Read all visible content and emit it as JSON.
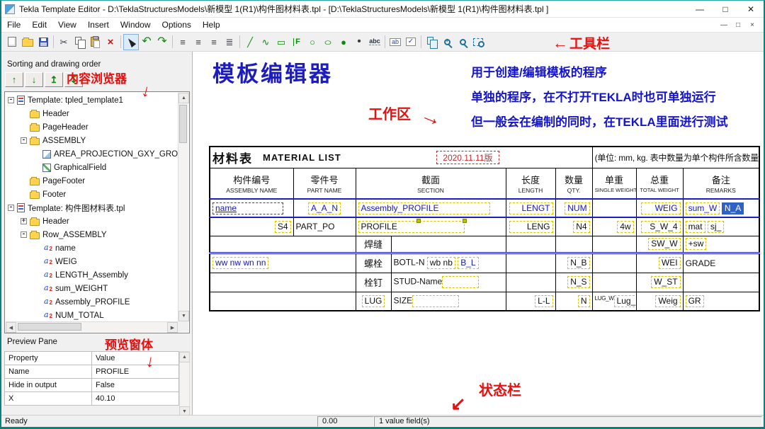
{
  "window": {
    "title": "Tekla Template Editor - D:\\TeklaStructuresModels\\新模型 1(R1)\\构件图材料表.tpl - [D:\\TeklaStructuresModels\\新模型 1(R1)\\构件图材料表.tpl ]",
    "controls": {
      "minimize": "—",
      "maximize": "□",
      "close": "✕"
    }
  },
  "menubar": {
    "items": [
      "File",
      "Edit",
      "View",
      "Insert",
      "Window",
      "Options",
      "Help"
    ],
    "mdi": {
      "minimize": "—",
      "restore": "□",
      "close": "×"
    }
  },
  "toolbar": {
    "icons": [
      {
        "name": "new-file",
        "glyph": ""
      },
      {
        "name": "open-file",
        "glyph": ""
      },
      {
        "name": "save",
        "glyph": ""
      },
      {
        "name": "cut",
        "glyph": "✂"
      },
      {
        "name": "copy",
        "glyph": ""
      },
      {
        "name": "paste",
        "glyph": ""
      },
      {
        "name": "delete",
        "glyph": "×"
      },
      {
        "name": "select-tool",
        "glyph": ""
      },
      {
        "name": "undo",
        "glyph": "↶"
      },
      {
        "name": "redo",
        "glyph": "↷"
      },
      {
        "name": "align-objects-left",
        "glyph": "≡"
      },
      {
        "name": "align-objects-center",
        "glyph": "≡"
      },
      {
        "name": "align-objects-right",
        "glyph": "≡"
      },
      {
        "name": "distribute-objects",
        "glyph": "≣"
      },
      {
        "name": "draw-line",
        "glyph": "╱"
      },
      {
        "name": "draw-polyline",
        "glyph": "∿"
      },
      {
        "name": "draw-rectangle",
        "glyph": "▭"
      },
      {
        "name": "draw-flag",
        "glyph": "F"
      },
      {
        "name": "draw-circle",
        "glyph": "○"
      },
      {
        "name": "draw-ellipse",
        "glyph": "○"
      },
      {
        "name": "draw-filled-circle",
        "glyph": "●"
      },
      {
        "name": "draw-point",
        "glyph": "•"
      },
      {
        "name": "text-tool",
        "glyph": "abc"
      },
      {
        "name": "value-field-tool",
        "glyph": "ab"
      },
      {
        "name": "graphical-field-tool",
        "glyph": "✓"
      },
      {
        "name": "pan-tool",
        "glyph": ""
      },
      {
        "name": "zoom-in",
        "glyph": ""
      },
      {
        "name": "zoom-out",
        "glyph": ""
      },
      {
        "name": "zoom-window",
        "glyph": ""
      }
    ]
  },
  "sidebar": {
    "title": "Sorting and drawing order",
    "sort_buttons": [
      "↑",
      "↓",
      "↥",
      "↧"
    ],
    "tree": {
      "items": [
        {
          "exp": "-",
          "label": "Template: tpled_template1"
        },
        {
          "exp": "",
          "label": "Header"
        },
        {
          "exp": "",
          "label": "PageHeader"
        },
        {
          "exp": "-",
          "label": "ASSEMBLY"
        },
        {
          "exp": "",
          "label": "AREA_PROJECTION_GXY_GRO"
        },
        {
          "exp": "",
          "label": "GraphicalField"
        },
        {
          "exp": "",
          "label": "PageFooter"
        },
        {
          "exp": "",
          "label": "Footer"
        },
        {
          "exp": "-",
          "label": "Template: 构件图材料表.tpl"
        },
        {
          "exp": "+",
          "label": "Header"
        },
        {
          "exp": "-",
          "label": "Row_ASSEMBLY"
        },
        {
          "exp": "",
          "label": "name"
        },
        {
          "exp": "",
          "label": "WEIG"
        },
        {
          "exp": "",
          "label": "LENGTH_Assembly"
        },
        {
          "exp": "",
          "label": "sum_WEIGHT"
        },
        {
          "exp": "",
          "label": "Assembly_PROFILE"
        },
        {
          "exp": "",
          "label": "NUM_TOTAL"
        }
      ]
    }
  },
  "workarea": {
    "heading": "模板编辑器",
    "desc": [
      "用于创建/编辑模板的程序",
      "单独的程序，在不打开TEKLA时也可单独运行",
      "但一般会在编制的同时，在TEKLA里面进行测试"
    ]
  },
  "annotations": {
    "toolbar": {
      "glyph": "←",
      "label": "工具栏"
    },
    "content_browser": {
      "glyph": "↓",
      "label": "内容浏览器"
    },
    "work_area": {
      "glyph": "→",
      "label": "工作区"
    },
    "preview_pane": {
      "glyph": "↓",
      "label": "预览窗体"
    },
    "status_bar": {
      "glyph": "↙",
      "label": "状态栏"
    }
  },
  "mat": {
    "title_cn": "材料表",
    "title_en": "MATERIAL LIST",
    "version": "2020.11.11版",
    "units": "(单位: mm, kg. 表中数量为单个构件所含数量)",
    "headers": [
      {
        "cn": "构件编号",
        "en": "ASSEMBLY NAME"
      },
      {
        "cn": "零件号",
        "en": "PART NAME"
      },
      {
        "cn": "截面",
        "en": "SECTION"
      },
      {
        "cn": "长度",
        "en": "LENGTH"
      },
      {
        "cn": "数量",
        "en": "QTY."
      },
      {
        "cn": "单重",
        "en": "SINGLE WEIGHT"
      },
      {
        "cn": "总重",
        "en": "TOTAL WEIGHT"
      },
      {
        "cn": "备注",
        "en": "REMARKS"
      }
    ],
    "r1": {
      "c1": "name",
      "c2": "A_A_N",
      "c3": "Assembly_PROFILE",
      "c4": "LENGT",
      "c5": "NUM",
      "c7": "WEIG",
      "c8a": "sum_W",
      "c8b": "N_A"
    },
    "r2": {
      "c1": "S4",
      "c2": "PART_PO",
      "c3": "PROFILE",
      "c4": "LENG",
      "c5": "N4",
      "c6": "4w",
      "c7": "S_W_4",
      "c8a": "mat",
      "c8b": "sj_"
    },
    "r3": {
      "c2": "焊缝",
      "c7": "SW_W",
      "c8": "+sw"
    },
    "r4": {
      "c1": "ww nw  wn nn",
      "c2": "螺栓",
      "c3a": "BOTL-N",
      "c3b": "wb nb",
      "c3c": "B_L",
      "c5": "N_B",
      "c7": "WEI",
      "c8": "GRADE"
    },
    "r5": {
      "c2": "栓钉",
      "c3": "STUD-Name",
      "c5": "N_S",
      "c7": "W_ST"
    },
    "r6": {
      "c2": "LUG",
      "c3": "SIZE",
      "c4": "L-L",
      "c5": "N",
      "c6a": "LUG_W",
      "c6b": "Lug_",
      "c7": "Weig",
      "c8": "GR"
    }
  },
  "preview": {
    "title": "Preview Pane",
    "headers": [
      "Property",
      "Value"
    ],
    "rows": [
      {
        "k": "Name",
        "v": "PROFILE"
      },
      {
        "k": "Hide in output",
        "v": "False"
      },
      {
        "k": "X",
        "v": "40.10"
      }
    ]
  },
  "status": {
    "ready": "Ready",
    "coord": "0.00",
    "fields": "1 value field(s)"
  }
}
